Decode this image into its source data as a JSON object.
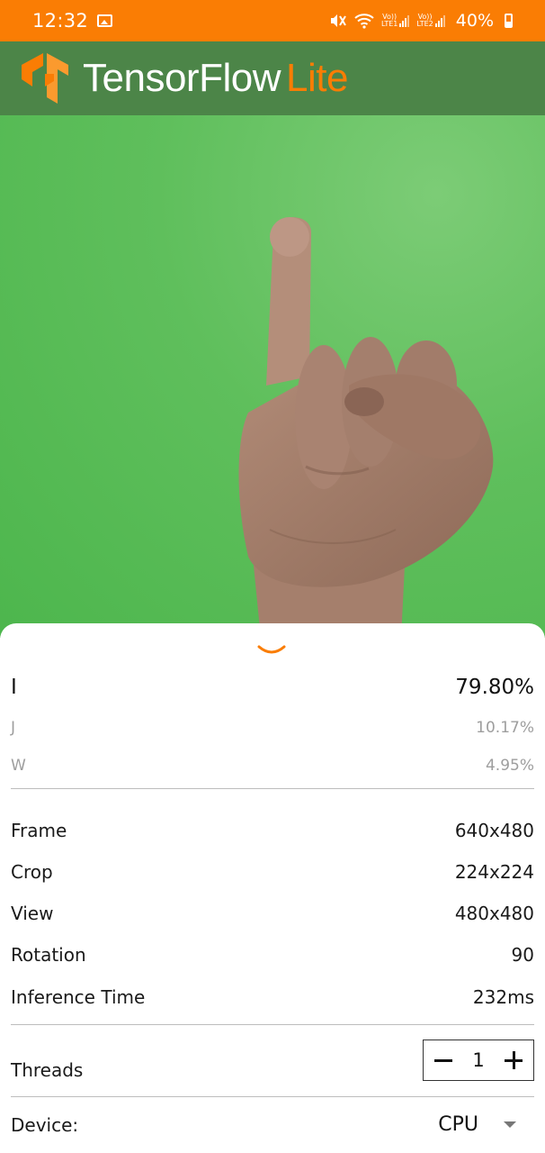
{
  "status_bar": {
    "time": "12:32",
    "net1_top": "Vo))",
    "net1_bottom": "LTE1",
    "net2_top": "Vo))",
    "net2_bottom": "LTE2",
    "battery": "40%"
  },
  "toolbar": {
    "brand_main": "TensorFlow",
    "brand_accent": "Lite",
    "bg_color": "#4c8548",
    "accent_color": "#fa7d04"
  },
  "results": [
    {
      "label": "I",
      "score": "79.80%"
    },
    {
      "label": "J",
      "score": "10.17%"
    },
    {
      "label": "W",
      "score": "4.95%"
    }
  ],
  "info": {
    "frame_label": "Frame",
    "frame_value": "640x480",
    "crop_label": "Crop",
    "crop_value": "224x224",
    "view_label": "View",
    "view_value": "480x480",
    "rotation_label": "Rotation",
    "rotation_value": "90",
    "inference_label": "Inference Time",
    "inference_value": "232ms"
  },
  "threads": {
    "label": "Threads",
    "value": "1"
  },
  "device": {
    "label": "Device:",
    "value": "CPU"
  }
}
